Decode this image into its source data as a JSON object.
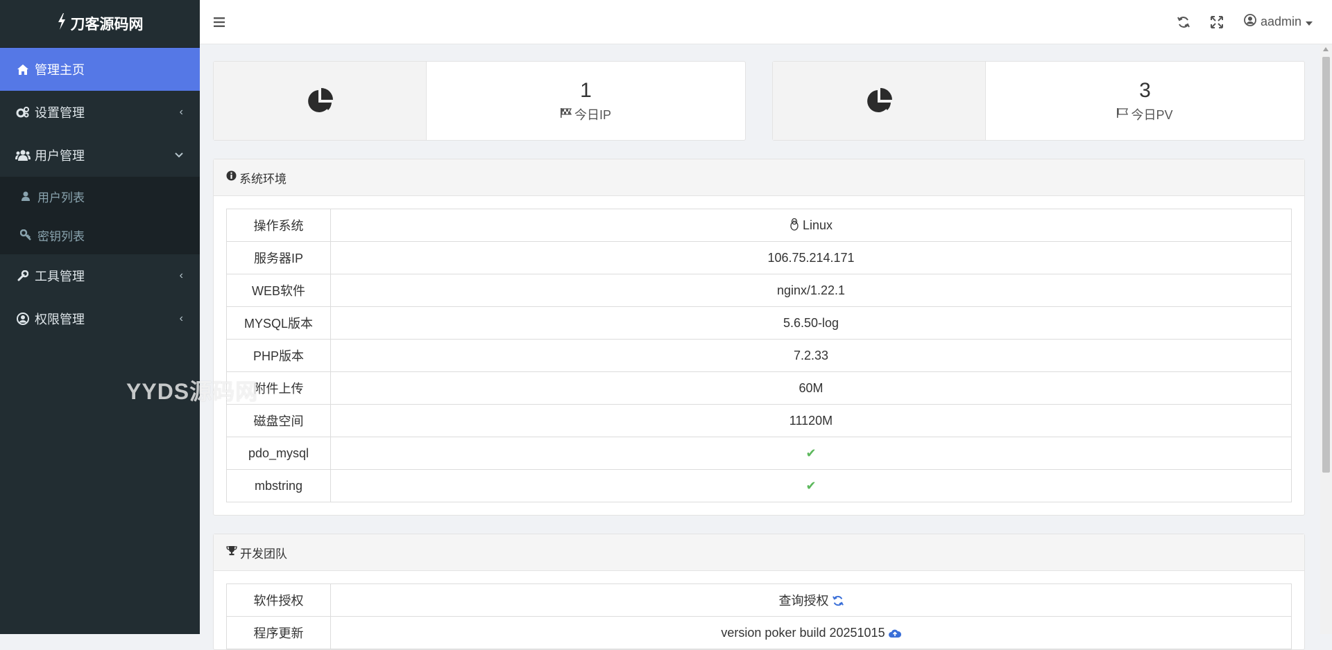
{
  "brand": {
    "title": "刀客源码网",
    "icon": "bolt-icon"
  },
  "sidebar": {
    "items": [
      {
        "label": "管理主页",
        "icon": "home-icon",
        "active": true
      },
      {
        "label": "设置管理",
        "icon": "cogs-icon",
        "arrow": "‹"
      },
      {
        "label": "用户管理",
        "icon": "users-icon",
        "arrow": "⌄",
        "children": [
          {
            "label": "用户列表",
            "icon": "user-icon"
          },
          {
            "label": "密钥列表",
            "icon": "key-icon"
          }
        ]
      },
      {
        "label": "工具管理",
        "icon": "wrench-icon",
        "arrow": "‹"
      },
      {
        "label": "权限管理",
        "icon": "user-circle-icon",
        "arrow": "‹"
      }
    ]
  },
  "topbar": {
    "menu_icon": "bars-icon",
    "refresh_icon": "refresh-icon",
    "fullscreen_icon": "expand-icon",
    "username": "aadmin"
  },
  "stats": [
    {
      "value": "1",
      "label": "今日IP",
      "icon": "pie-chart-icon",
      "label_icon": "flag-checkered-icon"
    },
    {
      "value": "3",
      "label": "今日PV",
      "icon": "pie-chart-icon",
      "label_icon": "flag-icon"
    }
  ],
  "env_panel": {
    "title": "系统环境",
    "rows": [
      {
        "key": "操作系统",
        "value": "Linux",
        "value_icon": "linux-icon"
      },
      {
        "key": "服务器IP",
        "value": "106.75.214.171"
      },
      {
        "key": "WEB软件",
        "value": "nginx/1.22.1"
      },
      {
        "key": "MYSQL版本",
        "value": "5.6.50-log"
      },
      {
        "key": "PHP版本",
        "value": "7.2.33"
      },
      {
        "key": "附件上传",
        "value": "60M"
      },
      {
        "key": "磁盘空间",
        "value": "11120M"
      },
      {
        "key": "pdo_mysql",
        "value": "✔"
      },
      {
        "key": "mbstring",
        "value": "✔"
      }
    ]
  },
  "team_panel": {
    "title": "开发团队",
    "rows": [
      {
        "key": "软件授权",
        "value": "查询授权"
      },
      {
        "key": "程序更新",
        "value": "version poker build 20251015"
      }
    ]
  },
  "watermark": "YYDS源码网",
  "colors": {
    "sidebar_bg": "#222d32",
    "active": "#5578e6",
    "check": "#5cb85c",
    "link_icon": "#3a6fd8"
  }
}
